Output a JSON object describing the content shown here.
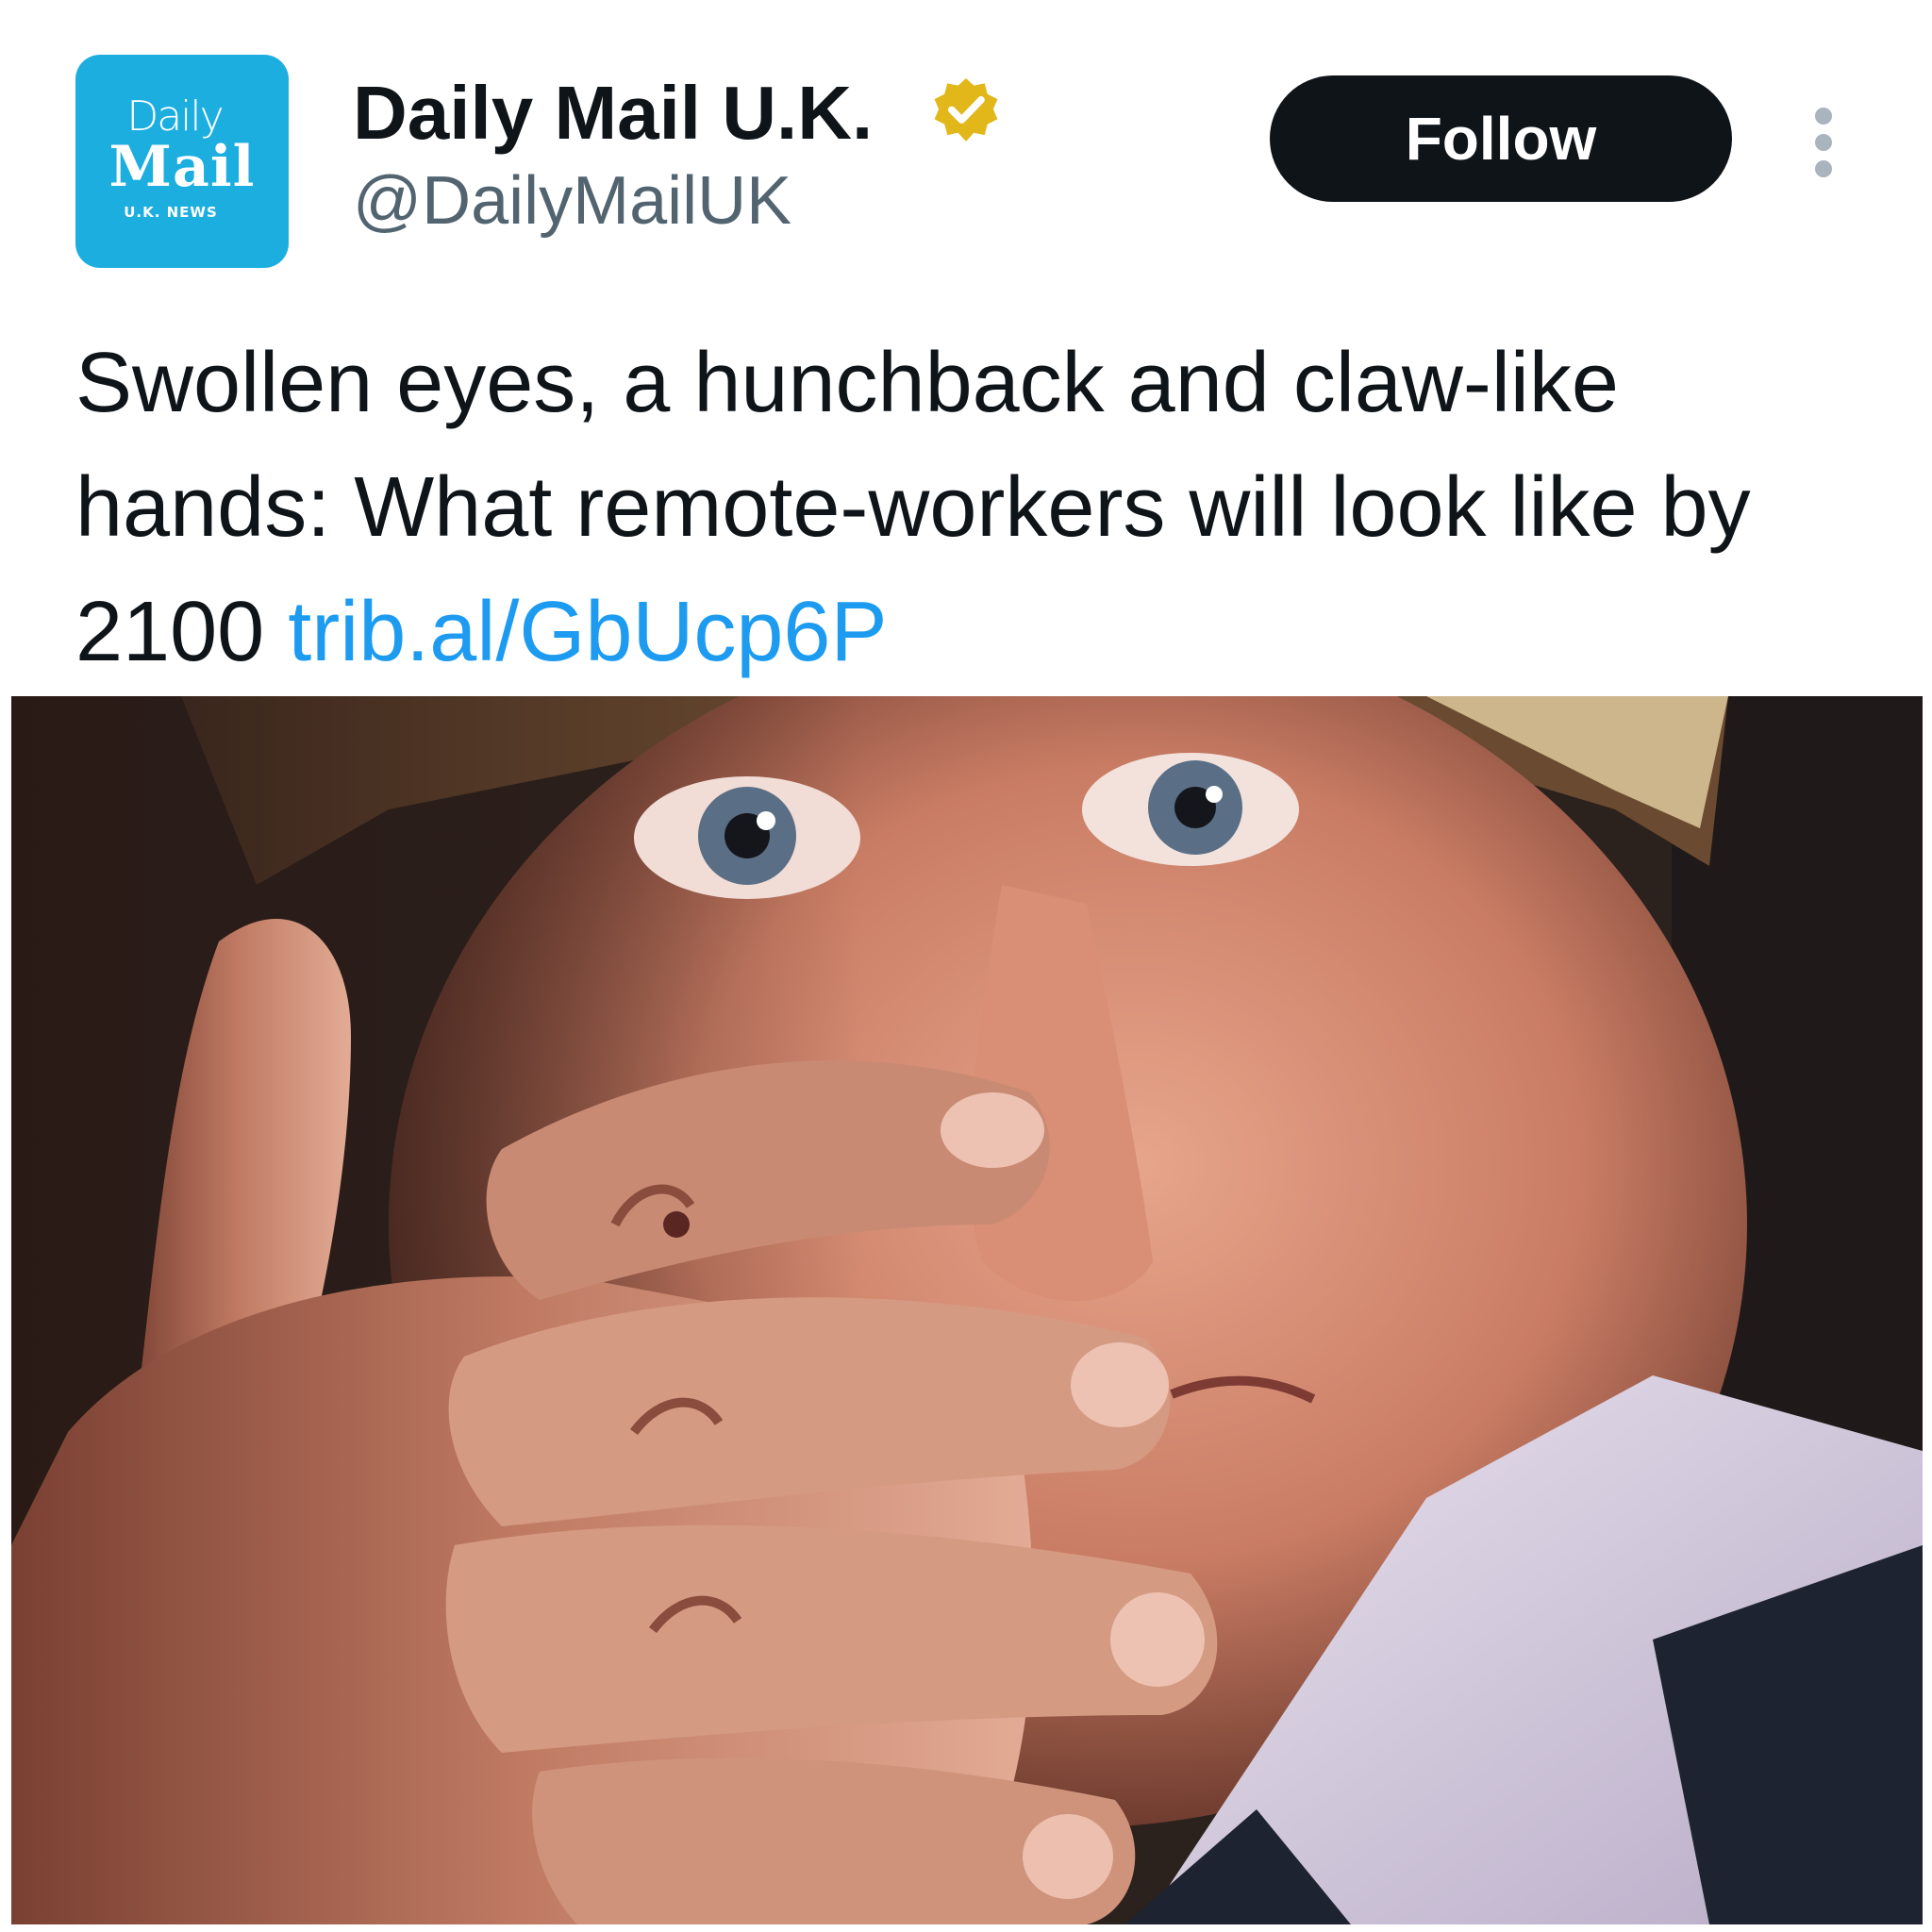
{
  "account": {
    "display_name": "Daily Mail U.K.",
    "handle": "@DailyMailUK",
    "avatar": {
      "line1": "Daily",
      "line2": "Mail",
      "line3": "U.K. NEWS",
      "background_color": "#1daee0"
    },
    "verified_badge_color": "#e2b719"
  },
  "actions": {
    "follow_label": "Follow",
    "more_icon": "more-vertical-icon"
  },
  "tweet": {
    "text": "Swollen eyes, a hunchback and claw-like hands: What remote-workers will look like by 2100",
    "link": "trib.al/GbUcp6P"
  },
  "media": {
    "icon": "photo-of-man-covering-mouth-with-hand"
  },
  "colors": {
    "text_primary": "#0f1419",
    "text_secondary": "#536471",
    "link": "#1d9bf0",
    "follow_bg": "#0f1419"
  }
}
